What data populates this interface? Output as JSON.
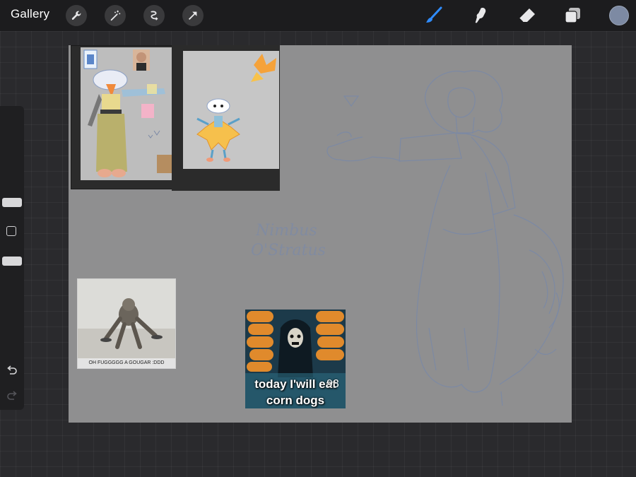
{
  "topbar": {
    "gallery_label": "Gallery",
    "left_tools": [
      "wrench-icon",
      "magic-wand-icon",
      "selection-icon",
      "transform-arrow-icon"
    ],
    "right_tools": [
      "brush-icon",
      "smudge-icon",
      "eraser-icon",
      "layers-icon"
    ],
    "active_tool": "brush-icon",
    "active_color": "#7d8aa3"
  },
  "sidebar": {
    "controls": [
      "brush-size-slider",
      "modify-button",
      "brush-opacity-slider",
      "undo-icon",
      "redo-icon"
    ]
  },
  "canvas": {
    "background": "#8f8f90",
    "sketch_text_line1": "Nimbus",
    "sketch_text_line2": "O'Stratus",
    "meme1_caption": "OH FUGGGGG A GOUGAR :DDD",
    "meme2_line1": "today I'will eat",
    "meme2_badge": "98",
    "meme2_line2": "corn dogs"
  },
  "colors": {
    "sketch_stroke": "#7b89a6",
    "toolbar_bg": "#1c1c1e",
    "brush_active": "#2f8cff"
  }
}
